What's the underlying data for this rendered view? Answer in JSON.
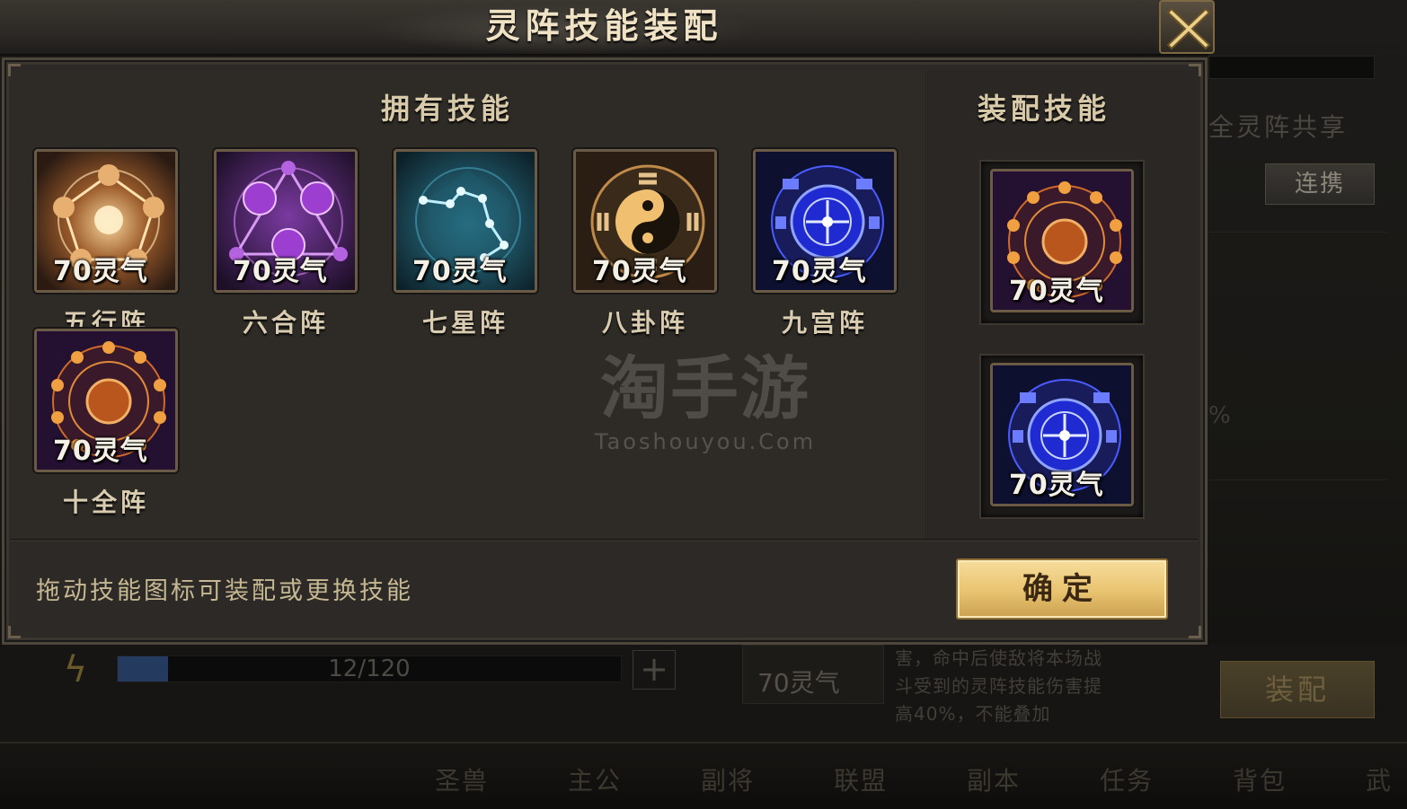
{
  "dialog": {
    "title": "灵阵技能装配",
    "owned_title": "拥有技能",
    "equipped_title": "装配技能",
    "hint": "拖动技能图标可装配或更换技能",
    "confirm_label": "确定",
    "close_icon": "close-x-icon"
  },
  "owned_skills": [
    {
      "name": "五行阵",
      "cost": "70灵气",
      "theme": "five-elements",
      "color": "#e2a65c"
    },
    {
      "name": "六合阵",
      "cost": "70灵气",
      "theme": "six-harmony",
      "color": "#b05ad6"
    },
    {
      "name": "七星阵",
      "cost": "70灵气",
      "theme": "seven-stars",
      "color": "#3fb2d6"
    },
    {
      "name": "八卦阵",
      "cost": "70灵气",
      "theme": "bagua",
      "color": "#d89a52"
    },
    {
      "name": "九宫阵",
      "cost": "70灵气",
      "theme": "nine-palace",
      "color": "#3e5cff"
    },
    {
      "name": "十全阵",
      "cost": "70灵气",
      "theme": "ten-perfect",
      "color": "#d0602a"
    }
  ],
  "equipped_skills": [
    {
      "cost": "70灵气",
      "theme": "ten-perfect"
    },
    {
      "cost": "70灵气",
      "theme": "nine-palace"
    }
  ],
  "watermark": {
    "title": "淘手游",
    "subtitle": "Taoshouyou.Com"
  },
  "background": {
    "share_text": "全灵阵共享",
    "link_button": "连携",
    "percent_fragment": "%",
    "energy": {
      "current": 12,
      "max": 120,
      "label": "12/120"
    },
    "small_skill_cost": "70灵气",
    "description_lines": [
      "害，命中后使敌将本场战",
      "斗受到的灵阵技能伤害提",
      "高40%，不能叠加"
    ],
    "equip_button": "装配",
    "nav": [
      "圣兽",
      "主公",
      "副将",
      "联盟",
      "副本",
      "任务",
      "背包",
      "武"
    ]
  }
}
